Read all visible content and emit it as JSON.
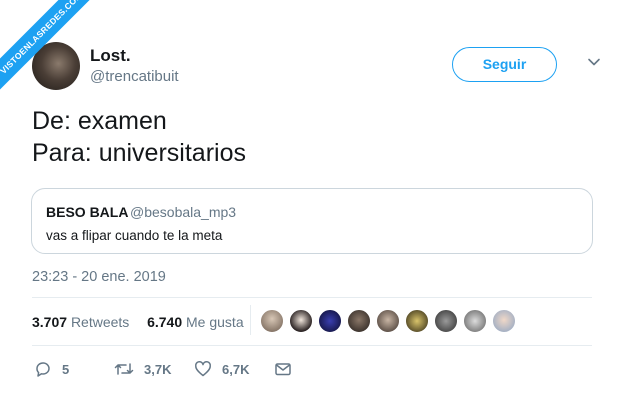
{
  "watermark": "VISTOENLASREDES.COM",
  "author": {
    "name": "Lost.",
    "handle": "@trencatibuit"
  },
  "follow_button": "Seguir",
  "tweet_lines": [
    "De: examen",
    "Para: universitarios"
  ],
  "quoted_tweet": {
    "name": "BESO BALA",
    "handle": "@besobala_mp3",
    "text": "vas a flipar cuando te la meta"
  },
  "timestamp": "23:23 - 20 ene. 2019",
  "stats": {
    "retweets": "3.707",
    "retweets_label": "Retweets",
    "likes": "6.740",
    "likes_label": "Me gusta"
  },
  "actions": {
    "replies": "5",
    "retweets": "3,7K",
    "likes": "6,7K"
  },
  "colors": {
    "accent": "#1da1f2",
    "muted": "#657786",
    "border": "#ccd6dd"
  }
}
